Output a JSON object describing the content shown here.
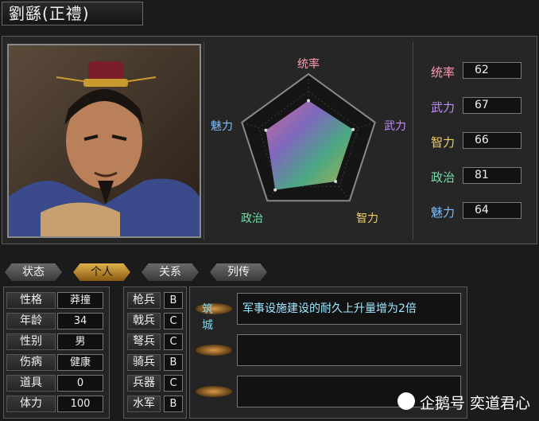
{
  "header": {
    "name": "劉繇(正禮)"
  },
  "stats": [
    {
      "label": "统率",
      "value": "62",
      "color": "#ff9ab0"
    },
    {
      "label": "武力",
      "value": "67",
      "color": "#c08cff"
    },
    {
      "label": "智力",
      "value": "66",
      "color": "#f0d060"
    },
    {
      "label": "政治",
      "value": "81",
      "color": "#70e0a8"
    },
    {
      "label": "魅力",
      "value": "64",
      "color": "#7ac0ff"
    }
  ],
  "radar": {
    "labels": [
      "统率",
      "武力",
      "智力",
      "政治",
      "魅力"
    ],
    "values": [
      62,
      67,
      66,
      81,
      64
    ],
    "max": 100
  },
  "tabs": [
    {
      "label": "状态",
      "active": false
    },
    {
      "label": "个人",
      "active": true
    },
    {
      "label": "关系",
      "active": false
    },
    {
      "label": "列传",
      "active": false
    }
  ],
  "personal": [
    {
      "label": "性格",
      "value": "莽撞"
    },
    {
      "label": "年龄",
      "value": "34"
    },
    {
      "label": "性别",
      "value": "男"
    },
    {
      "label": "伤病",
      "value": "健康"
    },
    {
      "label": "道具",
      "value": "0"
    },
    {
      "label": "体力",
      "value": "100"
    }
  ],
  "troops": [
    {
      "label": "枪兵",
      "grade": "B"
    },
    {
      "label": "戟兵",
      "grade": "C"
    },
    {
      "label": "弩兵",
      "grade": "C"
    },
    {
      "label": "骑兵",
      "grade": "B"
    },
    {
      "label": "兵器",
      "grade": "C"
    },
    {
      "label": "水军",
      "grade": "B"
    }
  ],
  "skills": [
    {
      "name": "筑城",
      "desc": "军事设施建设的耐久上升量增为2倍"
    },
    {
      "name": "",
      "desc": ""
    },
    {
      "name": "",
      "desc": ""
    }
  ],
  "watermark": {
    "text": "企鹅号 奕道君心",
    "icon": "penguin-icon"
  }
}
